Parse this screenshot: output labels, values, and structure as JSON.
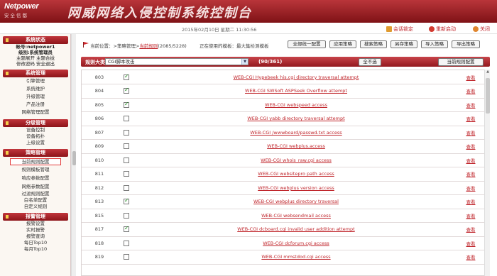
{
  "app": {
    "logo_brand": "Netpower",
    "logo_sub": "安全信都",
    "title": "网威网络入侵控制系统控制台"
  },
  "topbar": {
    "date": "2015年02月10日 星期二 11:30:56",
    "links": [
      {
        "label": "会话锁定",
        "icon": "lock-icon"
      },
      {
        "label": "重新启动",
        "icon": "restart-icon"
      },
      {
        "label": "关闭",
        "icon": "power-icon"
      }
    ]
  },
  "sidebar": {
    "system_status_head": "系统状态",
    "user_lines": [
      "帐号:netpower1",
      "级别:系统管理员",
      "主题展开 主题合拢",
      "修改密码 安全退出"
    ],
    "sections": [
      {
        "title": "系统管理",
        "items": [
          "引擎管理",
          "系统维护",
          "升级管理",
          "产品注册",
          "网络管理配置"
        ]
      },
      {
        "title": "分级管理",
        "items": [
          "设备控制",
          "设备拓扑",
          "上级设置"
        ]
      },
      {
        "title": "策略管理",
        "items": [
          "当前规则配置",
          "规则模板管理",
          "响应参数配置",
          "网络参数配置",
          "过滤规则配置",
          "白名单配置",
          "自定义规则"
        ]
      },
      {
        "title": "报警管理",
        "items": [
          "报警设置",
          "实时报警",
          "报警查询",
          "每日Top10",
          "每月Top10"
        ]
      }
    ]
  },
  "main": {
    "breadcrumb_prefix": "当前位置：",
    "breadcrumb_middle": ">策略管理>",
    "breadcrumb_link": "当前规则",
    "breadcrumb_count": "(2085/5228)",
    "status_note": "正在使用的模板：最大集检测模板",
    "buttons": [
      "全部统一配置",
      "应用策略",
      "搜索策略",
      "另存策略",
      "导入策略",
      "导出策略"
    ],
    "rule_label": "规则大类：",
    "rule_select": "CGI脚本攻击",
    "rule_count": "(90/361)",
    "btn_all": "全不选",
    "btn_config": "当前规则配置",
    "view_label": "查看"
  },
  "rules": [
    {
      "id": "803",
      "checked": true,
      "name": "WEB-CGI Hypebeek his.cgi directory traversal attempt"
    },
    {
      "id": "804",
      "checked": true,
      "name": "WEB-CGI SWSoft ASPSeek Overflow attempt"
    },
    {
      "id": "805",
      "checked": true,
      "name": "WEB-CGI webspeed access"
    },
    {
      "id": "806",
      "checked": false,
      "name": "WEB-CGI yabb directory traversal attempt"
    },
    {
      "id": "807",
      "checked": false,
      "name": "WEB-CGI /wwwboard/passwd.txt access"
    },
    {
      "id": "809",
      "checked": false,
      "name": "WEB-CGI webplus.access"
    },
    {
      "id": "810",
      "checked": false,
      "name": "WEB-CGI whois_raw.cgi access"
    },
    {
      "id": "811",
      "checked": false,
      "name": "WEB-CGI websitepro path access"
    },
    {
      "id": "812",
      "checked": false,
      "name": "WEB-CGI webplus version access"
    },
    {
      "id": "813",
      "checked": true,
      "name": "WEB-CGI webplus directory traversal"
    },
    {
      "id": "815",
      "checked": false,
      "name": "WEB-CGI websendmail access"
    },
    {
      "id": "817",
      "checked": true,
      "name": "WEB-CGI dcboard.cgi invalid user addition attempt"
    },
    {
      "id": "818",
      "checked": false,
      "name": "WEB-CGI dcforum.cgi access"
    },
    {
      "id": "819",
      "checked": false,
      "name": "WEB-CGI mmstdod.cgi access"
    }
  ]
}
